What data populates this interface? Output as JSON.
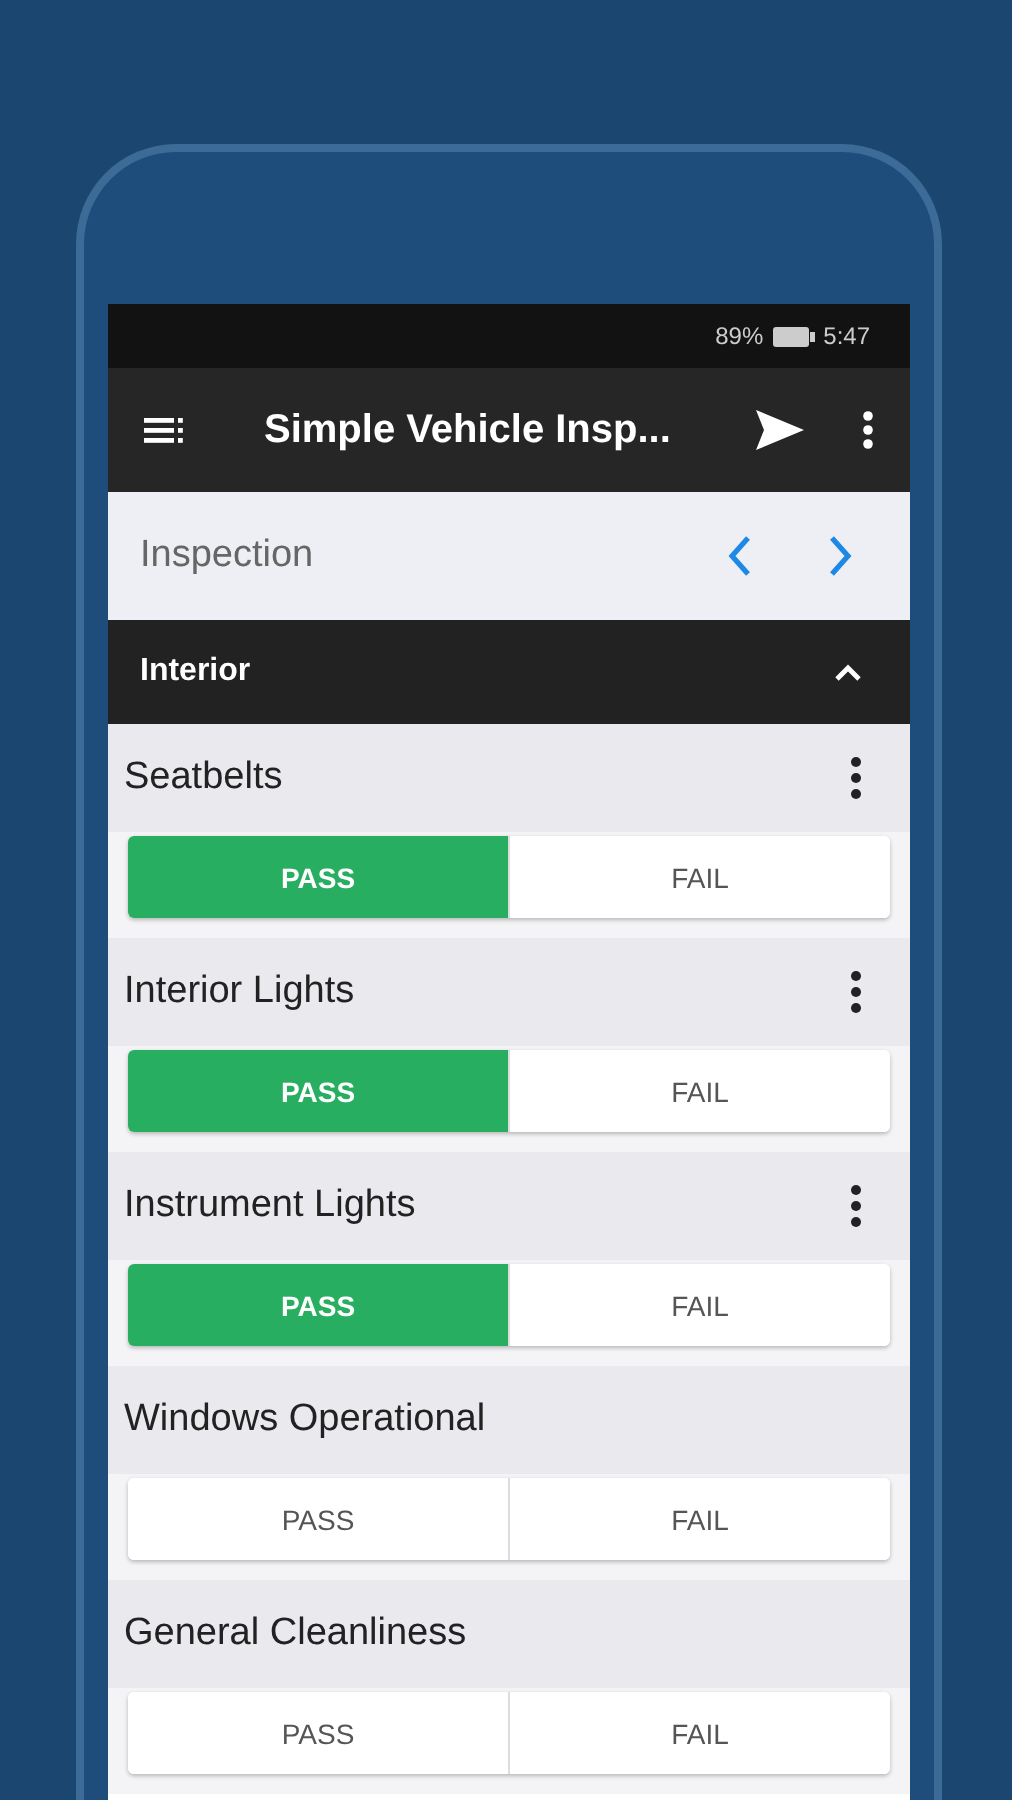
{
  "status_bar": {
    "battery": "89%",
    "time": "5:47"
  },
  "toolbar": {
    "title": "Simple Vehicle Insp..."
  },
  "nav": {
    "label": "Inspection"
  },
  "section": {
    "title": "Interior",
    "expanded": true
  },
  "items": [
    {
      "name": "Seatbelts",
      "has_menu": true,
      "buttons": [
        {
          "label": "PASS",
          "selected": true
        },
        {
          "label": "FAIL",
          "selected": false
        }
      ]
    },
    {
      "name": "Interior Lights",
      "has_menu": true,
      "buttons": [
        {
          "label": "PASS",
          "selected": true
        },
        {
          "label": "FAIL",
          "selected": false
        }
      ]
    },
    {
      "name": "Instrument Lights",
      "has_menu": true,
      "buttons": [
        {
          "label": "PASS",
          "selected": true
        },
        {
          "label": "FAIL",
          "selected": false
        }
      ]
    },
    {
      "name": "Windows Operational",
      "has_menu": false,
      "buttons": [
        {
          "label": "PASS",
          "selected": false
        },
        {
          "label": "FAIL",
          "selected": false
        }
      ]
    },
    {
      "name": "General Cleanliness",
      "has_menu": false,
      "buttons": [
        {
          "label": "PASS",
          "selected": false
        },
        {
          "label": "FAIL",
          "selected": false
        }
      ]
    }
  ]
}
